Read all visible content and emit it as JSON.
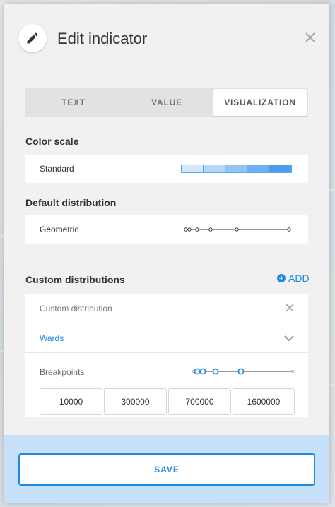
{
  "modal": {
    "title": "Edit indicator"
  },
  "tabs": [
    {
      "label": "TEXT",
      "active": false
    },
    {
      "label": "VALUE",
      "active": false
    },
    {
      "label": "VISUALIZATION",
      "active": true
    }
  ],
  "color_scale": {
    "section_label": "Color scale",
    "value": "Standard",
    "swatches": [
      "#d4e8fb",
      "#b6d8f8",
      "#93c5f4",
      "#6fb1f0",
      "#4c9deb"
    ]
  },
  "default_distribution": {
    "section_label": "Default distribution",
    "value": "Geometric"
  },
  "custom_distributions": {
    "section_label": "Custom distributions",
    "add_label": "ADD",
    "item": {
      "name_placeholder": "Custom distribution",
      "area_value": "Wards",
      "breakpoints_label": "Breakpoints",
      "breakpoints": [
        "10000",
        "300000",
        "700000",
        "1600000"
      ]
    }
  },
  "footer": {
    "save_label": "SAVE"
  },
  "colors": {
    "accent": "#1e88e5",
    "footer_bg": "#c7e1fb"
  },
  "icons": {
    "edit": "pencil-icon",
    "close": "close-icon",
    "add": "plus-circle-icon",
    "remove": "close-icon",
    "dropdown": "chevron-down-icon"
  }
}
